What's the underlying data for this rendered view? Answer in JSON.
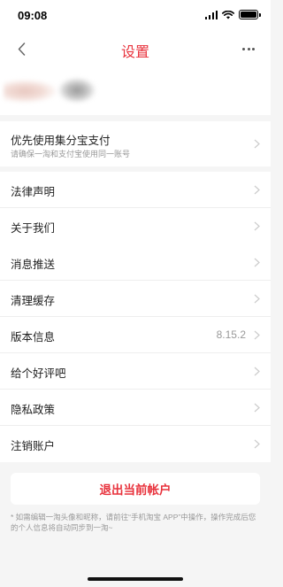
{
  "status_bar": {
    "time": "09:08"
  },
  "nav": {
    "title": "设置"
  },
  "groups": [
    {
      "items": [
        {
          "label": "优先使用集分宝支付",
          "sub": "请确保一淘和支付宝使用同一账号"
        }
      ]
    },
    {
      "items": [
        {
          "label": "法律声明"
        },
        {
          "label": "关于我们"
        }
      ]
    },
    {
      "items": [
        {
          "label": "消息推送"
        },
        {
          "label": "清理缓存"
        },
        {
          "label": "版本信息",
          "value": "8.15.2"
        },
        {
          "label": "给个好评吧"
        },
        {
          "label": "隐私政策"
        },
        {
          "label": "注销账户"
        }
      ]
    }
  ],
  "logout": {
    "label": "退出当前帐户"
  },
  "footnote": "* 如需编辑一淘头像和昵称，请前往“手机淘宝 APP”中操作，操作完成后您的个人信息将自动同步到一淘~",
  "colors": {
    "accent": "#e8323c",
    "background": "#f5f5f5"
  }
}
